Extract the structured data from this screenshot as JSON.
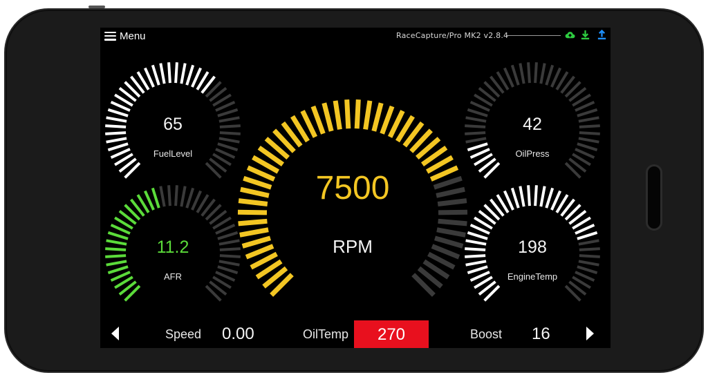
{
  "app": {
    "menu_label": "Menu",
    "title": "RaceCapture/Pro MK2 v2.8.4",
    "icons": [
      "cloud-upload-icon",
      "download-icon",
      "upload-icon"
    ],
    "icon_colors": {
      "cloud": "#2ecc40",
      "download": "#2ecc40",
      "upload": "#1e90ff"
    }
  },
  "gauges": [
    {
      "id": "rpm",
      "value": "7500",
      "label": "RPM",
      "fill": 0.75,
      "color": "#f3c623"
    },
    {
      "id": "fuel",
      "value": "65",
      "label": "FuelLevel",
      "fill": 0.65,
      "color": "#ffffff"
    },
    {
      "id": "oilpress",
      "value": "42",
      "label": "OilPress",
      "fill": 0.13,
      "color": "#ffffff"
    },
    {
      "id": "afr",
      "value": "11.2",
      "label": "AFR",
      "fill": 0.45,
      "color": "#5bdb3a"
    },
    {
      "id": "enginetemp",
      "value": "198",
      "label": "EngineTemp",
      "fill": 0.78,
      "color": "#ffffff"
    }
  ],
  "bottom": {
    "speed_label": "Speed",
    "speed_value": "0.00",
    "oiltemp_label": "OilTemp",
    "oiltemp_value": "270",
    "oiltemp_alarm_color": "#e8101e",
    "boost_label": "Boost",
    "boost_value": "16"
  },
  "colors": {
    "inactive_tick": "#3a3a3a",
    "background": "#000000"
  }
}
